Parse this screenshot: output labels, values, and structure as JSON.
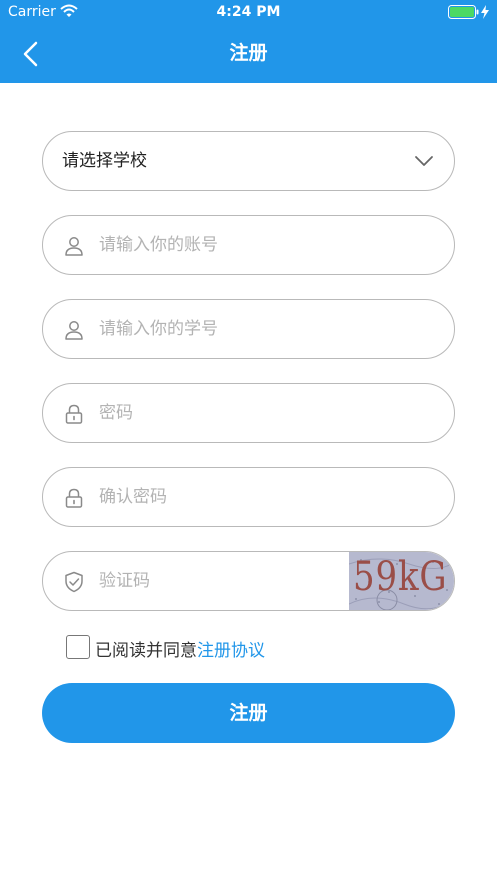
{
  "status_bar": {
    "carrier": "Carrier",
    "time": "4:24 PM",
    "icons": [
      "wifi-icon",
      "battery-icon",
      "charging-bolt-icon"
    ]
  },
  "nav": {
    "title": "注册",
    "back_icon": "chevron-left-icon"
  },
  "form": {
    "school_select": {
      "value": "请选择学校",
      "icon": "chevron-down-icon"
    },
    "account_input": {
      "placeholder": "请输入你的账号",
      "value": "",
      "icon": "user-icon"
    },
    "student_id_input": {
      "placeholder": "请输入你的学号",
      "value": "",
      "icon": "user-icon"
    },
    "password_input": {
      "placeholder": "密码",
      "value": "",
      "icon": "lock-icon"
    },
    "confirm_password_input": {
      "placeholder": "确认密码",
      "value": "",
      "icon": "lock-icon"
    },
    "captcha_input": {
      "placeholder": "验证码",
      "value": "",
      "icon": "shield-check-icon"
    },
    "captcha_image_text": "59kG"
  },
  "agreement": {
    "checked": false,
    "prefix": "已阅读并同意",
    "link": "注册协议"
  },
  "submit": {
    "label": "注册"
  },
  "colors": {
    "primary": "#2196e9",
    "border": "#b9b9b9",
    "placeholder": "#b3b3b3",
    "text": "#333333",
    "battery": "#4cd964"
  }
}
